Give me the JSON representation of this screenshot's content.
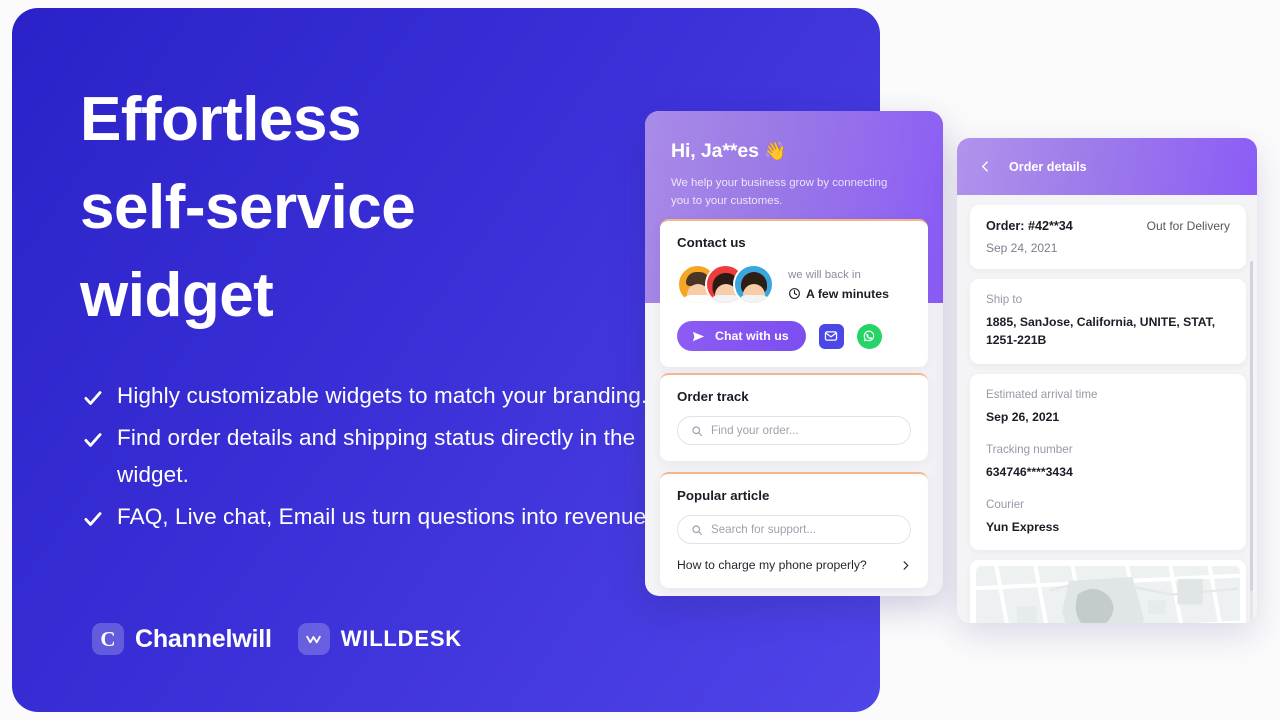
{
  "hero": {
    "title_lines": [
      "Effortless",
      "self-service",
      "widget"
    ],
    "bullets": [
      "Highly customizable widgets to match your branding.",
      "Find order details and shipping status directly in the widget.",
      "FAQ, Live chat, Email us turn questions into revenue."
    ],
    "logos": [
      {
        "mark": "C",
        "name": "Channelwill",
        "icon": "channelwill-logo-icon"
      },
      {
        "mark": "w",
        "name": "WILLDESK",
        "icon": "willdesk-logo-icon"
      }
    ],
    "colors": {
      "gradient_start": "#2a22c8",
      "gradient_end": "#4f44e8"
    }
  },
  "widget": {
    "greeting": "Hi, Ja**es",
    "wave_emoji": "👋",
    "subtitle": "We help your business grow by connecting you to your customes.",
    "contact": {
      "title": "Contact us",
      "reply_label": "we will back in",
      "reply_time": "A few minutes",
      "clock_icon": "clock-icon",
      "chat_button": "Chat with us",
      "send_icon": "send-icon",
      "mail_icon": "mail-icon",
      "whatsapp_icon": "whatsapp-icon",
      "avatar_colors": [
        "#f5a623",
        "#ee3b3b",
        "#3aa6dd"
      ]
    },
    "order_track": {
      "title": "Order track",
      "search_placeholder": "Find your order...",
      "search_icon": "search-icon"
    },
    "popular_article": {
      "title": "Popular article",
      "search_placeholder": "Search for support...",
      "search_icon": "search-icon",
      "articles": [
        {
          "text": "How to charge my phone properly?",
          "chevron": "chevron-right-icon"
        }
      ]
    },
    "colors": {
      "header_start": "#a98be8",
      "header_end": "#8b5cf6",
      "card_accent": "#f6b48a"
    }
  },
  "order_details": {
    "header": {
      "title": "Order details",
      "back_icon": "chevron-left-icon"
    },
    "summary": {
      "order_number": "Order: #42**34",
      "status": "Out for Delivery",
      "date": "Sep 24, 2021"
    },
    "ship_to": {
      "label": "Ship to",
      "address": "1885, SanJose, California, UNITE, STAT, 1251-221B"
    },
    "tracking": [
      {
        "label": "Estimated arrival time",
        "value": "Sep 26, 2021"
      },
      {
        "label": "Tracking number",
        "value": "634746****3434"
      },
      {
        "label": "Courier",
        "value": "Yun Express"
      }
    ],
    "map": {
      "name": "delivery-map"
    },
    "colors": {
      "header_start": "#b193ec",
      "header_end": "#8b5cf6"
    }
  }
}
